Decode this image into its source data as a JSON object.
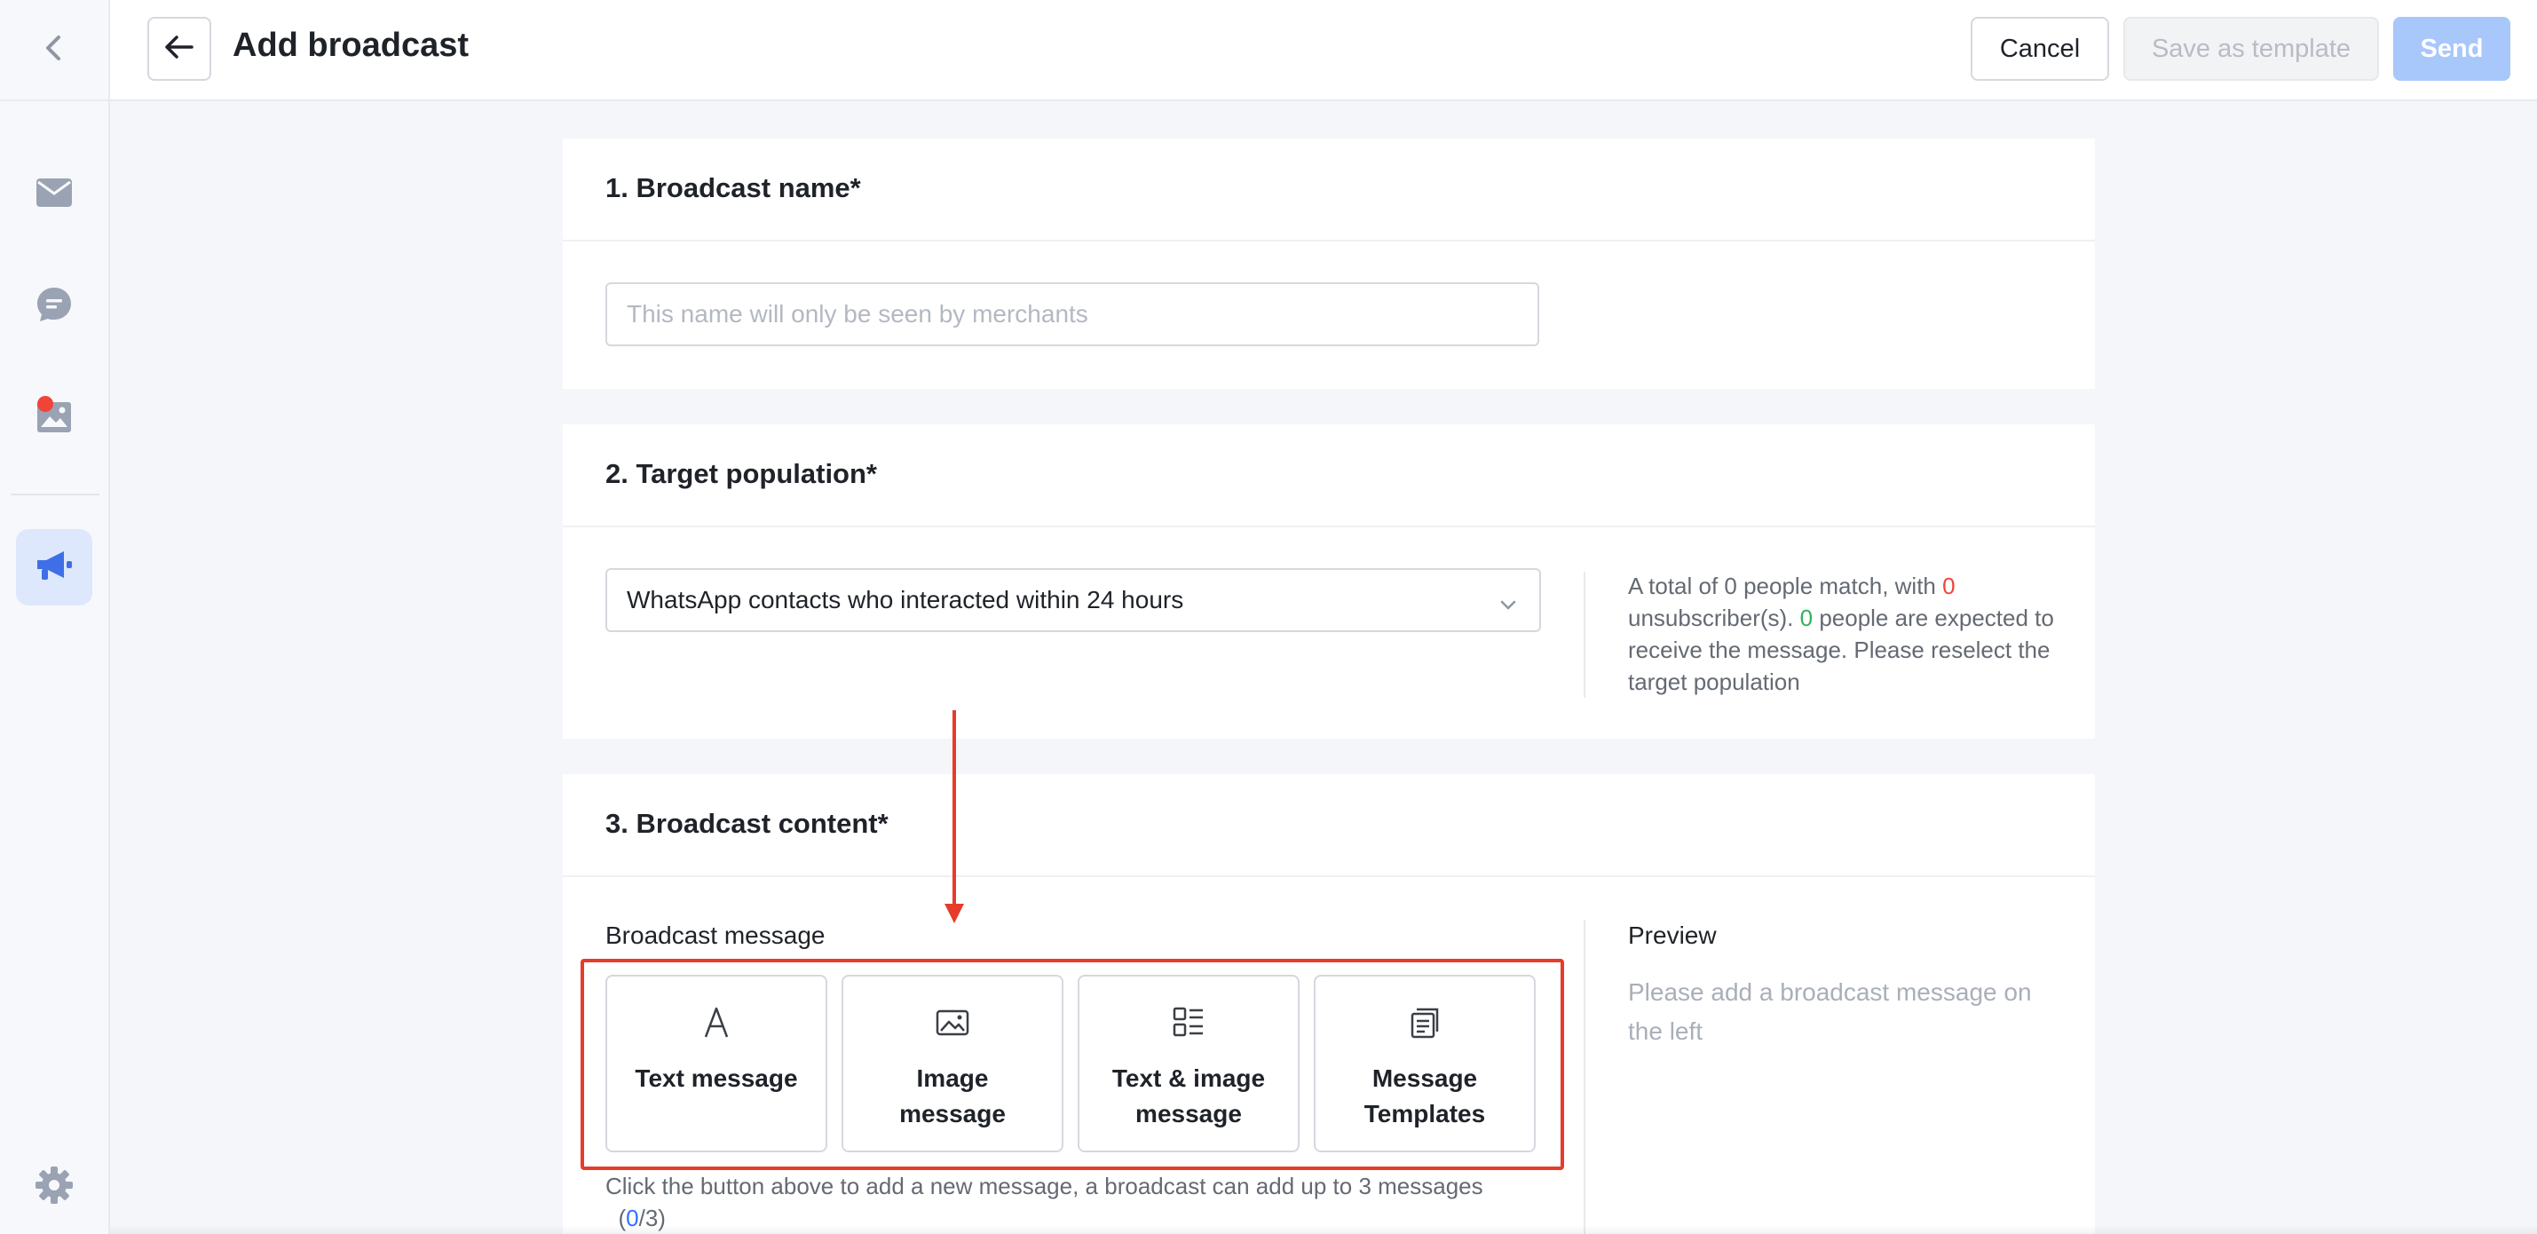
{
  "app": {
    "title": "Add broadcast"
  },
  "sidebar": {
    "items": [
      {
        "icon": "chevron-left-icon"
      },
      {
        "icon": "mail-icon"
      },
      {
        "icon": "chat-icon"
      },
      {
        "icon": "image-notification-icon",
        "badge": "red-dot"
      },
      {
        "icon": "megaphone-icon",
        "active": true
      },
      {
        "icon": "gear-icon"
      }
    ]
  },
  "header": {
    "title": "Add broadcast",
    "cancel_label": "Cancel",
    "save_template_label": "Save as template",
    "send_label": "Send"
  },
  "section1": {
    "title": "1. Broadcast name*",
    "input_placeholder": "This name will only be seen by merchants",
    "input_value": ""
  },
  "section2": {
    "title": "2. Target population*",
    "select_value": "WhatsApp contacts who interacted within 24 hours",
    "info_part1": "A total of 0 people match, with ",
    "unsubscribers": "0",
    "info_part2": " unsubscriber(s). ",
    "expected": "0",
    "info_part3": " people are expected to receive the message. Please reselect the target population"
  },
  "section3": {
    "title": "3. Broadcast content*",
    "message_label": "Broadcast message",
    "preview_label": "Preview",
    "preview_placeholder": "Please add a broadcast message on the left",
    "buttons": [
      {
        "label_line1": "Text message",
        "label_line2": "",
        "icon": "text-icon"
      },
      {
        "label_line1": "Image",
        "label_line2": "message",
        "icon": "image-icon"
      },
      {
        "label_line1": "Text & image",
        "label_line2": "message",
        "icon": "text-image-icon"
      },
      {
        "label_line1": "Message",
        "label_line2": "Templates",
        "icon": "templates-icon"
      }
    ],
    "hint_text": "Click the button above to add a new message, a broadcast can add up to 3 messages",
    "count_open": "(",
    "count_current": "0",
    "count_max": "/3)"
  },
  "colors": {
    "primary": "#3370ff",
    "send_disabled": "#a8c7fb",
    "annotation": "#e53c2c",
    "unsubscriber_red": "#f04438",
    "expected_green": "#2fb45a"
  }
}
